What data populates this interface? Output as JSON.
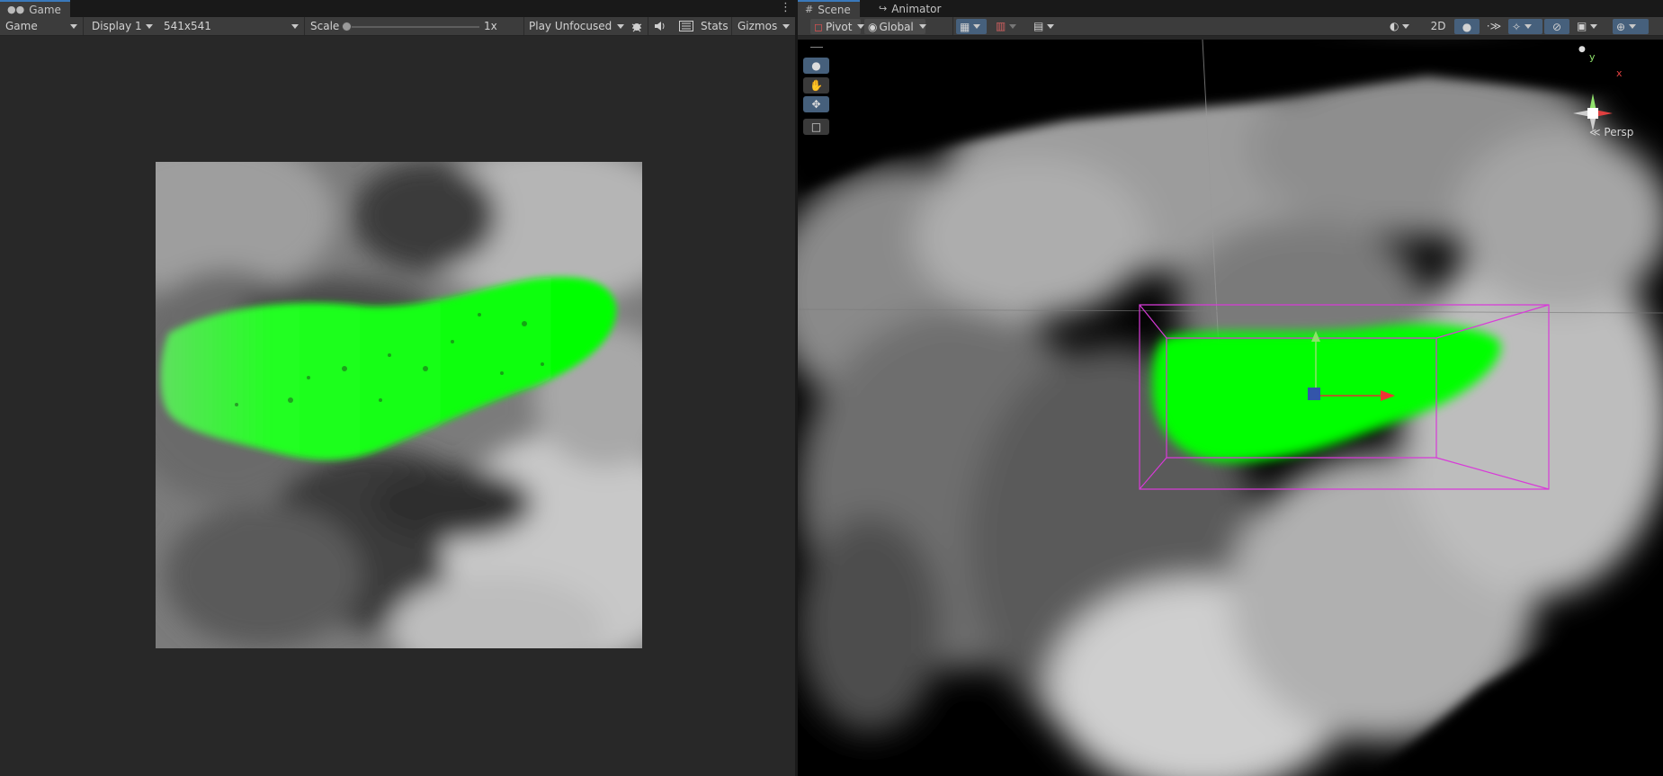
{
  "game": {
    "tab_label": "Game",
    "tab_icon": "gamepad-icon",
    "display_mode": "Game",
    "display": "Display 1",
    "resolution": "541x541",
    "scale_label": "Scale",
    "scale_value": "1x",
    "play_mode": "Play Unfocused",
    "stats_label": "Stats",
    "gizmos_label": "Gizmos",
    "more_menu": "⋮"
  },
  "scene": {
    "tabs": [
      {
        "label": "Scene",
        "icon": "grid-icon"
      },
      {
        "label": "Animator",
        "icon": "animator-icon"
      }
    ],
    "pivot_label": "Pivot",
    "global_label": "Global",
    "mode_2d_label": "2D",
    "persp_label": "Persp",
    "axis_labels": {
      "y": "y",
      "x": "x"
    },
    "colors": {
      "highlight_green": "#00ff00",
      "selection_box": "#d83ad8",
      "accent_blue": "#3a79bb"
    }
  }
}
